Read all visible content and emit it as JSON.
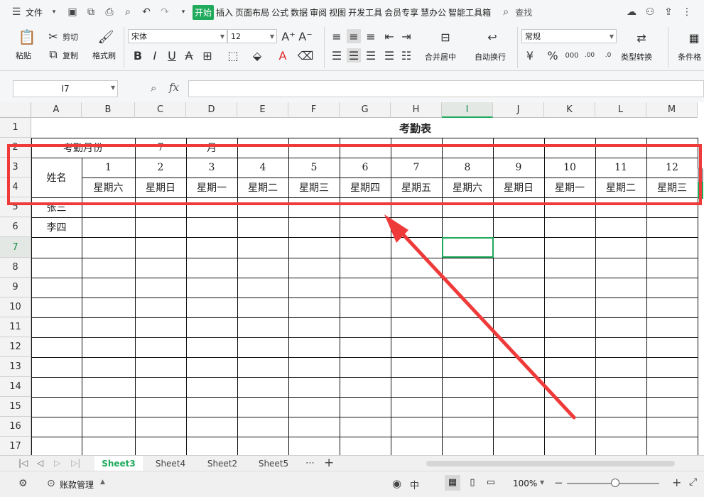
{
  "menubar": {
    "menu_label": "文件",
    "tabs": [
      "开始",
      "插入",
      "页面布局",
      "公式",
      "数据",
      "审阅",
      "视图",
      "开发工具",
      "会员专享",
      "慧办公",
      "智能工具箱"
    ],
    "search_label": "查找"
  },
  "ribbon": {
    "paste": "粘贴",
    "cut": "剪切",
    "copy": "复制",
    "format_painter": "格式刷",
    "font_name": "宋体",
    "font_size": "12",
    "merge_center": "合并居中",
    "wrap_text": "自动换行",
    "number_format": "常规",
    "type_convert": "类型转换",
    "conditional_format": "条件格"
  },
  "formula": {
    "cell_ref": "I7",
    "fx_label": "fx",
    "value": ""
  },
  "grid": {
    "columns": [
      "A",
      "B",
      "C",
      "D",
      "E",
      "F",
      "G",
      "H",
      "I",
      "J",
      "K",
      "L",
      "M"
    ],
    "active_column": "I",
    "rows": [
      "1",
      "2",
      "3",
      "4",
      "5",
      "6",
      "7",
      "8",
      "9",
      "10",
      "11",
      "12",
      "13",
      "14",
      "15",
      "16",
      "17"
    ],
    "active_row": "7",
    "title": "考勤表",
    "month_label": "考勤月份",
    "month_value": "7",
    "month_unit": "月",
    "name_header": "姓名",
    "days": [
      "1",
      "2",
      "3",
      "4",
      "5",
      "6",
      "7",
      "8",
      "9",
      "10",
      "11",
      "12"
    ],
    "weekdays": [
      "星期六",
      "星期日",
      "星期一",
      "星期二",
      "星期三",
      "星期四",
      "星期五",
      "星期六",
      "星期日",
      "星期一",
      "星期二",
      "星期三"
    ],
    "names": [
      "张三",
      "李四"
    ]
  },
  "sheets": {
    "tabs": [
      "Sheet3",
      "Sheet4",
      "Sheet2",
      "Sheet5"
    ],
    "active": "Sheet3"
  },
  "status": {
    "account": "账款管理",
    "zoom": "100%"
  },
  "colors": {
    "accent": "#1faa5c",
    "annotation": "#ef3a3a"
  }
}
